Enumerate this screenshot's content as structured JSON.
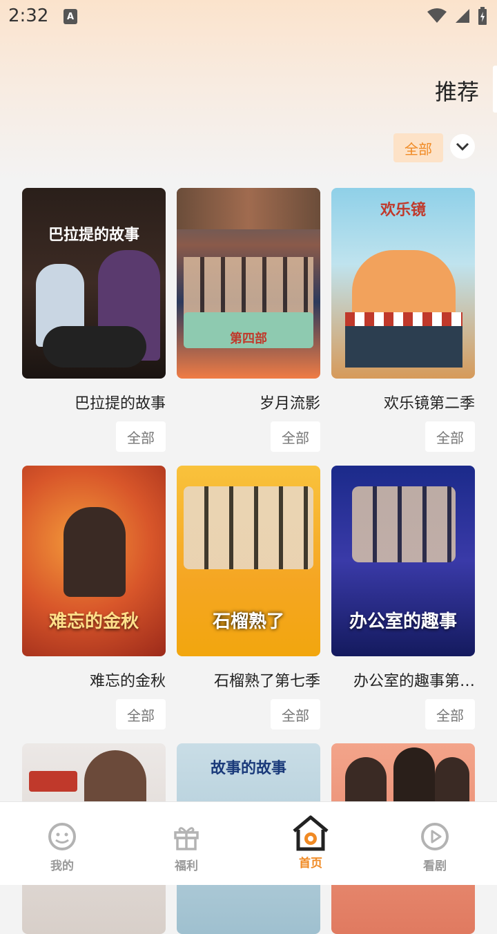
{
  "status_bar": {
    "time": "2:32",
    "notification_icon": "a-icon",
    "icons": [
      "wifi-icon",
      "signal-icon",
      "battery-icon"
    ]
  },
  "header": {
    "title": "推荐"
  },
  "filter": {
    "label": "全部",
    "expand_icon": "chevron-down-icon"
  },
  "shows": [
    {
      "title": "巴拉提的故事",
      "button": "全部",
      "poster_caption": "巴拉提的故事"
    },
    {
      "title": "岁月流影",
      "button": "全部",
      "poster_caption": "第四部"
    },
    {
      "title": "欢乐镜第二季",
      "button": "全部",
      "poster_caption": "欢乐镜"
    },
    {
      "title": "难忘的金秋",
      "button": "全部",
      "poster_caption": "难忘的金秋"
    },
    {
      "title": "石榴熟了第七季",
      "button": "全部",
      "poster_caption": "石榴熟了"
    },
    {
      "title": "办公室的趣事第…",
      "button": "全部",
      "poster_caption": "办公室的趣事"
    },
    {
      "title": "",
      "button": "",
      "poster_caption": ""
    },
    {
      "title": "",
      "button": "",
      "poster_caption": "故事的故事"
    },
    {
      "title": "",
      "button": "",
      "poster_caption": ""
    }
  ],
  "nav": [
    {
      "label": "我的",
      "icon": "smiley-icon"
    },
    {
      "label": "福利",
      "icon": "gift-icon"
    },
    {
      "label": "首页",
      "icon": "home-icon"
    },
    {
      "label": "看剧",
      "icon": "play-icon"
    }
  ],
  "colors": {
    "accent": "#f08a24",
    "chip_bg": "#fde2c7"
  }
}
